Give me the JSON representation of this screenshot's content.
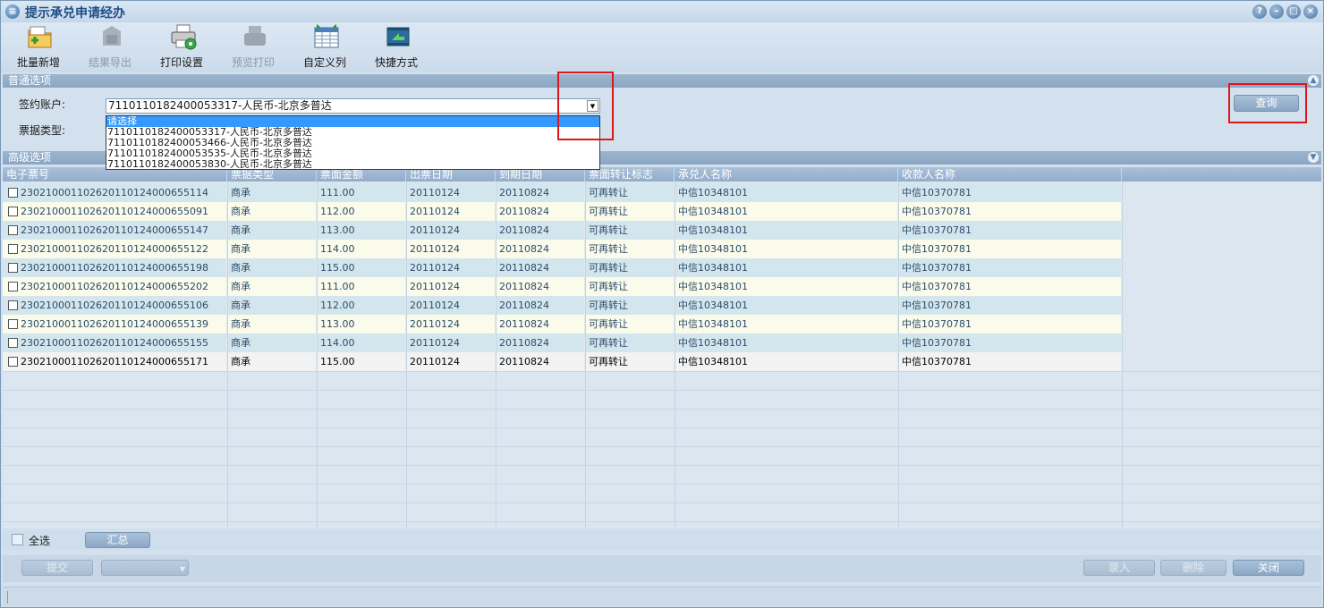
{
  "window": {
    "title": "提示承兑申请经办",
    "title_icon": "app-icon",
    "controls": [
      "help-icon",
      "minimize-icon",
      "restore-icon",
      "close-icon"
    ]
  },
  "toolbar": {
    "items": [
      {
        "label": "批量新增",
        "icon": "folder-add-icon",
        "enabled": true
      },
      {
        "label": "结果导出",
        "icon": "export-icon",
        "enabled": false
      },
      {
        "label": "打印设置",
        "icon": "printer-settings-icon",
        "enabled": true
      },
      {
        "label": "预览打印",
        "icon": "print-preview-icon",
        "enabled": false
      },
      {
        "label": "自定义列",
        "icon": "custom-columns-icon",
        "enabled": true
      },
      {
        "label": "快捷方式",
        "icon": "shortcut-icon",
        "enabled": true
      }
    ]
  },
  "sections": {
    "general": "普通选项",
    "advanced": "高级选项"
  },
  "filters": {
    "account_label": "签约账户:",
    "account_value": "7110110182400053317-人民币-北京多普达",
    "bill_type_label": "票据类型:",
    "options": [
      "请选择",
      "7110110182400053317-人民币-北京多普达",
      "7110110182400053466-人民币-北京多普达",
      "7110110182400053535-人民币-北京多普达",
      "7110110182400053830-人民币-北京多普达"
    ],
    "selected_option_index": 0
  },
  "query_button": "查询",
  "grid": {
    "columns": [
      "电子票号",
      "票据类型",
      "票面金额",
      "出票日期",
      "到期日期",
      "票面转让标志",
      "承兑人名称",
      "收款人名称"
    ],
    "rows": [
      [
        "230210001102620110124000655114",
        "商承",
        "111.00",
        "20110124",
        "20110824",
        "可再转让",
        "中信10348101",
        "中信10370781"
      ],
      [
        "230210001102620110124000655091",
        "商承",
        "112.00",
        "20110124",
        "20110824",
        "可再转让",
        "中信10348101",
        "中信10370781"
      ],
      [
        "230210001102620110124000655147",
        "商承",
        "113.00",
        "20110124",
        "20110824",
        "可再转让",
        "中信10348101",
        "中信10370781"
      ],
      [
        "230210001102620110124000655122",
        "商承",
        "114.00",
        "20110124",
        "20110824",
        "可再转让",
        "中信10348101",
        "中信10370781"
      ],
      [
        "230210001102620110124000655198",
        "商承",
        "115.00",
        "20110124",
        "20110824",
        "可再转让",
        "中信10348101",
        "中信10370781"
      ],
      [
        "230210001102620110124000655202",
        "商承",
        "111.00",
        "20110124",
        "20110824",
        "可再转让",
        "中信10348101",
        "中信10370781"
      ],
      [
        "230210001102620110124000655106",
        "商承",
        "112.00",
        "20110124",
        "20110824",
        "可再转让",
        "中信10348101",
        "中信10370781"
      ],
      [
        "230210001102620110124000655139",
        "商承",
        "113.00",
        "20110124",
        "20110824",
        "可再转让",
        "中信10348101",
        "中信10370781"
      ],
      [
        "230210001102620110124000655155",
        "商承",
        "114.00",
        "20110124",
        "20110824",
        "可再转让",
        "中信10348101",
        "中信10370781"
      ],
      [
        "230210001102620110124000655171",
        "商承",
        "115.00",
        "20110124",
        "20110824",
        "可再转让",
        "中信10348101",
        "中信10370781"
      ]
    ]
  },
  "summary": {
    "select_all_label": "全选",
    "summary_button": "汇总"
  },
  "actions": {
    "submit": "提交",
    "record": "录入",
    "delete": "删除",
    "close": "关闭"
  },
  "colors": {
    "highlight_box": "#e0161b",
    "selected_option": "#3399ff",
    "title_text": "#1f4e86"
  }
}
